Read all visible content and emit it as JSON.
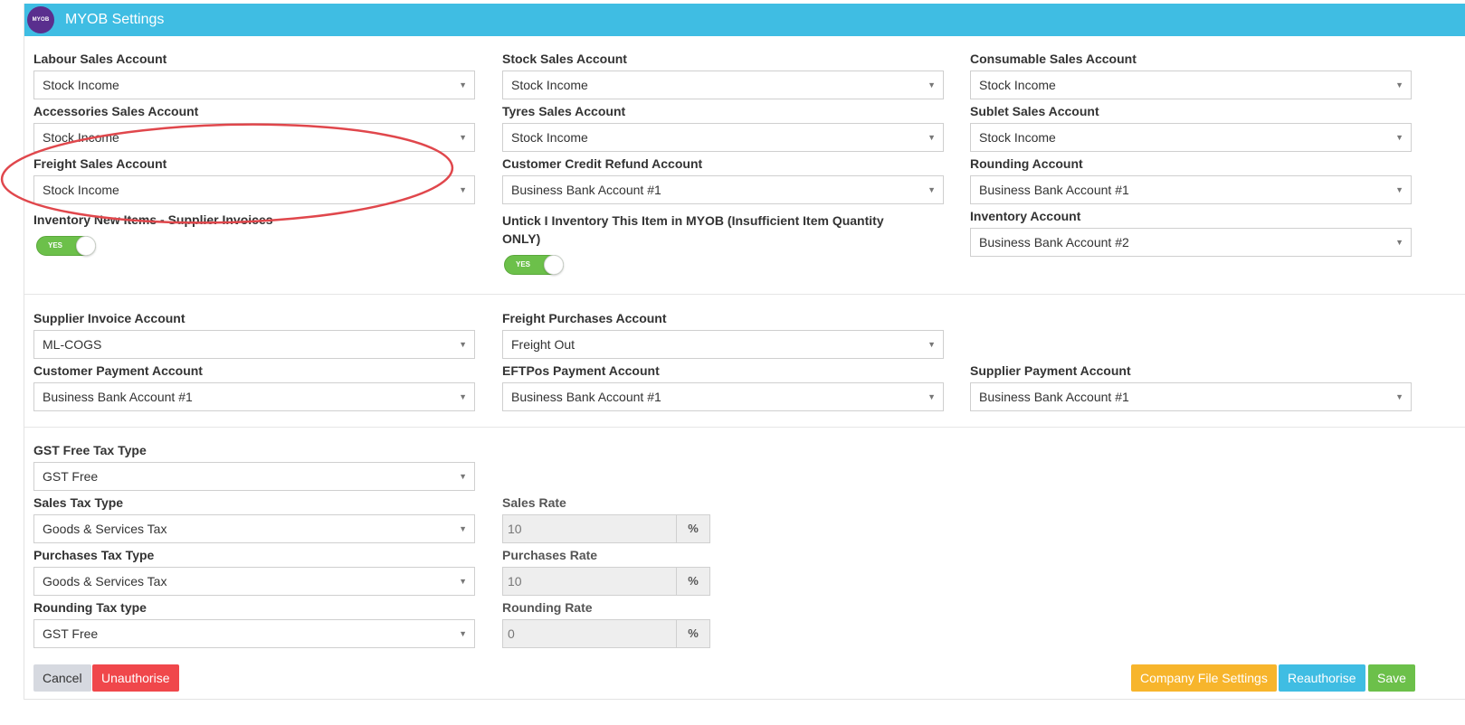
{
  "header": {
    "logo_text": "MYOB",
    "title": "MYOB Settings"
  },
  "accounts_section": {
    "fields": [
      {
        "label": "Labour Sales Account",
        "value": "Stock Income"
      },
      {
        "label": "Stock Sales Account",
        "value": "Stock Income"
      },
      {
        "label": "Consumable Sales Account",
        "value": "Stock Income"
      },
      {
        "label": "Accessories Sales Account",
        "value": "Stock Income"
      },
      {
        "label": "Tyres Sales Account",
        "value": "Stock Income"
      },
      {
        "label": "Sublet Sales Account",
        "value": "Stock Income"
      },
      {
        "label": "Freight Sales Account",
        "value": "Stock Income"
      },
      {
        "label": "Customer Credit Refund Account",
        "value": "Business Bank Account #1"
      },
      {
        "label": "Rounding Account",
        "value": "Business Bank Account #1"
      },
      {
        "label": "Inventory Account",
        "value": "Business Bank Account #2"
      }
    ],
    "toggles": [
      {
        "label": "Inventory New Items - Supplier Invoices",
        "state": "YES"
      },
      {
        "label_line1": "Untick I Inventory This Item in MYOB (Insufficient Item Quantity",
        "label_line2": "ONLY)",
        "state": "YES"
      }
    ]
  },
  "payments_section": {
    "fields": [
      {
        "label": "Supplier Invoice Account",
        "value": "ML-COGS"
      },
      {
        "label": "Freight Purchases Account",
        "value": "Freight Out"
      },
      {
        "label": "Customer Payment Account",
        "value": "Business Bank Account #1"
      },
      {
        "label": "EFTPos Payment Account",
        "value": "Business Bank Account #1"
      },
      {
        "label": "Supplier Payment Account",
        "value": "Business Bank Account #1"
      }
    ]
  },
  "tax_section": {
    "fields": [
      {
        "label": "GST Free Tax Type",
        "value": "GST Free"
      },
      {
        "label": "Sales Tax Type",
        "value": "Goods & Services Tax"
      },
      {
        "label": "Purchases Tax Type",
        "value": "Goods & Services Tax"
      },
      {
        "label": "Rounding Tax type",
        "value": "GST Free"
      }
    ],
    "rates": [
      {
        "label": "Sales Rate",
        "value": "10",
        "unit": "%"
      },
      {
        "label": "Purchases Rate",
        "value": "10",
        "unit": "%"
      },
      {
        "label": "Rounding Rate",
        "value": "0",
        "unit": "%"
      }
    ]
  },
  "footer": {
    "cancel_label": "Cancel",
    "unauthorise_label": "Unauthorise",
    "company_file_settings_label": "Company File Settings",
    "reauthorise_label": "Reauthorise",
    "save_label": "Save"
  },
  "colors": {
    "header_bg": "#3fbde3",
    "logo_bg": "#5a2f8e",
    "toggle_on": "#6cc04a",
    "cancel_bg": "#d6d9e0",
    "unauthorise_bg": "#f0474b",
    "company_file_bg": "#f7b52c",
    "reauthorise_bg": "#3fbde3",
    "save_bg": "#6cc04a",
    "annotation_red": "#e0474c"
  },
  "icons": {
    "dropdown": "caret-down-icon",
    "logo": "myob-logo-icon"
  }
}
